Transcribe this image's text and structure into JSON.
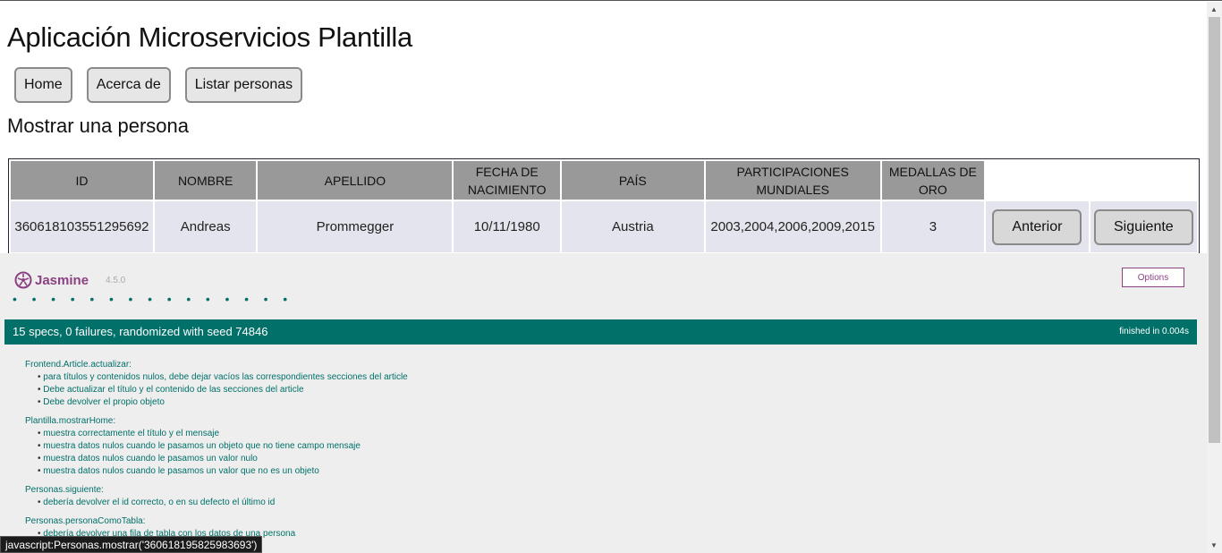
{
  "app": {
    "title": "Aplicación Microservicios Plantilla"
  },
  "nav": [
    {
      "label": "Home"
    },
    {
      "label": "Acerca de"
    },
    {
      "label": "Listar personas"
    }
  ],
  "section_title": "Mostrar una persona",
  "table": {
    "headers": [
      "ID",
      "NOMBRE",
      "APELLIDO",
      "FECHA DE NACIMIENTO",
      "PAÍS",
      "PARTICIPACIONES MUNDIALES",
      "MEDALLAS DE ORO"
    ],
    "row": [
      "360618103551295692",
      "Andreas",
      "Prommegger",
      "10/11/1980",
      "Austria",
      "2003,2004,2006,2009,2015",
      "3"
    ],
    "prev_label": "Anterior",
    "next_label": "Siguiente"
  },
  "jasmine": {
    "brand": "Jasmine",
    "version": "4.5.0",
    "options_label": "Options",
    "dots": "• • • • • • • • • • • • • • •",
    "summary": "15 specs, 0 failures, randomized with seed 74846",
    "duration": "finished in 0.004s",
    "suites": [
      {
        "title": "Frontend.Article.actualizar:",
        "specs": [
          "para títulos y contenidos nulos, debe dejar vacíos las correspondientes secciones del article",
          "Debe actualizar el título y el contenido de las secciones del article",
          "Debe devolver el propio objeto"
        ]
      },
      {
        "title": "Plantilla.mostrarHome:",
        "specs": [
          "muestra correctamente el título y el mensaje",
          "muestra datos nulos cuando le pasamos un objeto que no tiene campo mensaje",
          "muestra datos nulos cuando le pasamos un valor nulo",
          "muestra datos nulos cuando le pasamos un valor que no es un objeto"
        ]
      },
      {
        "title": "Personas.siguiente:",
        "specs": [
          "debería devolver el id correcto, o en su defecto el último id"
        ]
      },
      {
        "title": "Personas.personaComoTabla:",
        "specs": [
          "debería devolver una fila de tabla con los datos de una persona"
        ]
      }
    ]
  },
  "status_bar": "javascript:Personas.mostrar('360618195825983693')",
  "colors": {
    "jasmine_green": "#007069",
    "jasmine_purple": "#8a4182",
    "header_gray": "#999999"
  }
}
